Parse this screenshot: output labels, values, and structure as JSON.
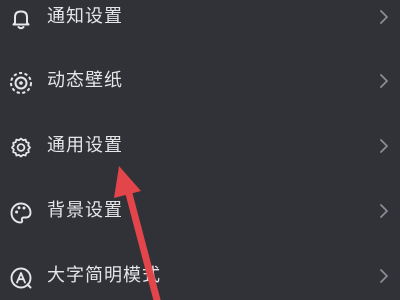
{
  "menu": {
    "items": [
      {
        "label": "通知设置",
        "icon": "bell-icon"
      },
      {
        "label": "动态壁纸",
        "icon": "live-wallpaper-icon"
      },
      {
        "label": "通用设置",
        "icon": "gear-icon"
      },
      {
        "label": "背景设置",
        "icon": "palette-icon"
      },
      {
        "label": "大字简明模式",
        "icon": "large-font-icon"
      }
    ],
    "chevron_icon": "chevron-right-icon"
  },
  "colors": {
    "background": "#303238",
    "text": "#e6e6e8",
    "chevron": "#8a8c91",
    "annotation_arrow": "#e2454a"
  }
}
